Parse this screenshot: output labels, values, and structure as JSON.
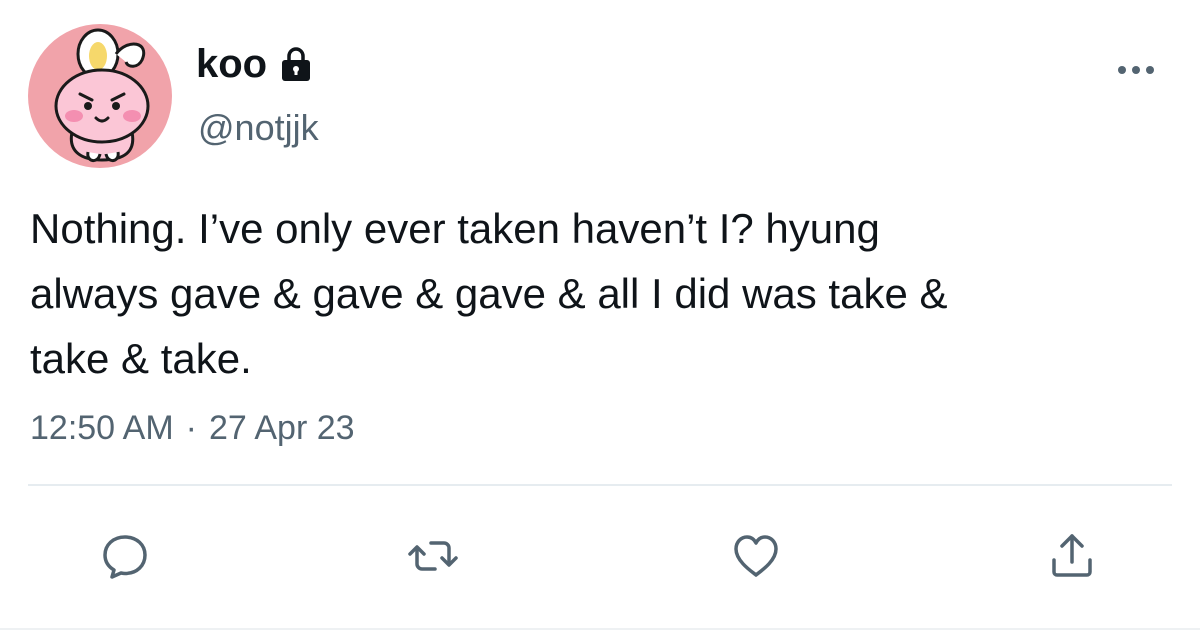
{
  "tweet": {
    "author": {
      "display_name": "koo",
      "handle": "@notjjk",
      "protected": true,
      "avatar_icon": "pink-bunny-character-avatar"
    },
    "text": "Nothing. I’ve only ever taken haven’t I? hyung\nalways gave & gave & gave & all I did was take &\ntake & take.",
    "time": "12:50 AM",
    "separator": "·",
    "date": "27 Apr 23"
  },
  "actions": [
    {
      "name": "reply",
      "icon": "speech-bubble-icon"
    },
    {
      "name": "retweet",
      "icon": "retweet-icon"
    },
    {
      "name": "like",
      "icon": "heart-icon"
    },
    {
      "name": "share",
      "icon": "share-upload-icon"
    }
  ],
  "colors": {
    "text": "#0f1419",
    "secondary": "#536471",
    "divider": "#e6ecf0",
    "avatar_bg": "#f1a3aa",
    "bunny_face": "#fbc6d6"
  }
}
